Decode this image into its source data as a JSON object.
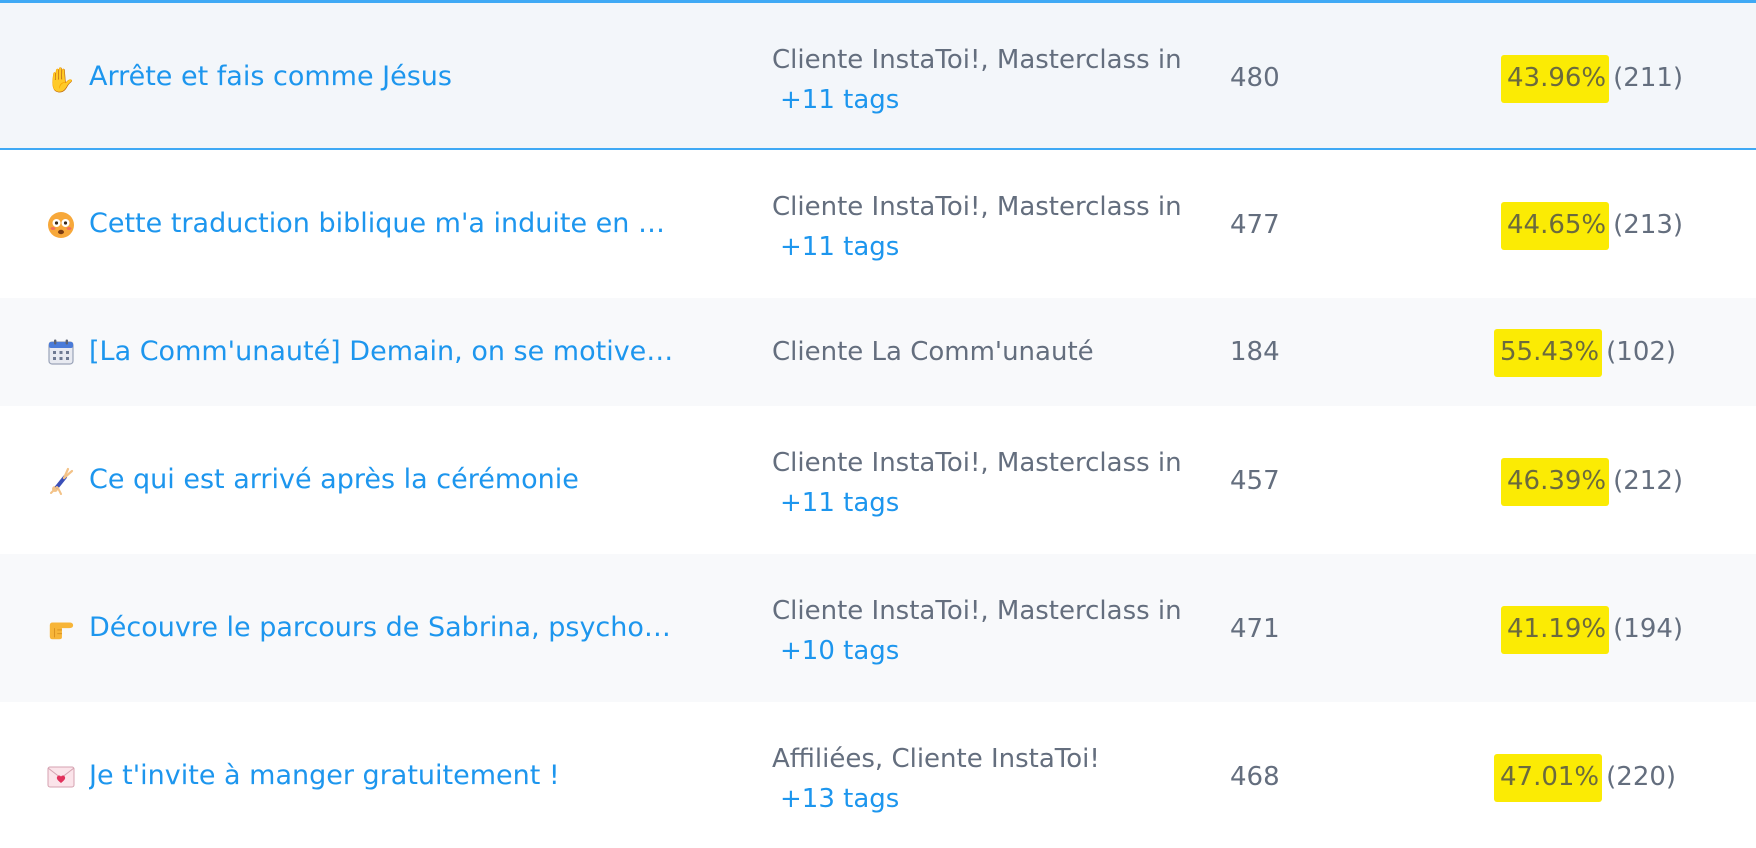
{
  "rows": [
    {
      "emoji": "raised-hand-icon",
      "title": "Arrête et fais comme Jésus",
      "tags": "Cliente InstaToi!, Masterclass instagram",
      "more_tags": "+11 tags",
      "count": "480",
      "rate": "43.96%",
      "rate_count": "(211)"
    },
    {
      "emoji": "flushed-face-icon",
      "title": "Cette traduction biblique m'a induite en erreur",
      "tags": "Cliente InstaToi!, Masterclass instagram",
      "more_tags": "+11 tags",
      "count": "477",
      "rate": "44.65%",
      "rate_count": "(213)"
    },
    {
      "emoji": "calendar-icon",
      "title": "[La Comm'unauté] Demain, on se motive pour",
      "tags": "Cliente La Comm'unauté",
      "more_tags": "",
      "count": "184",
      "rate": "55.43%",
      "rate_count": "(102)"
    },
    {
      "emoji": "cartwheel-icon",
      "title": "Ce qui est arrivé après la cérémonie",
      "tags": "Cliente InstaToi!, Masterclass instagram",
      "more_tags": "+11 tags",
      "count": "457",
      "rate": "46.39%",
      "rate_count": "(212)"
    },
    {
      "emoji": "pointing-right-icon",
      "title": "Découvre le parcours de Sabrina, psychothérapeute",
      "tags": "Cliente InstaToi!, Masterclass instagram",
      "more_tags": "+10 tags",
      "count": "471",
      "rate": "41.19%",
      "rate_count": "(194)"
    },
    {
      "emoji": "love-letter-icon",
      "title": "Je t'invite à manger gratuitement !",
      "tags": "Affiliées, Cliente InstaToi!",
      "more_tags": "+13 tags",
      "count": "468",
      "rate": "47.01%",
      "rate_count": "(220)"
    }
  ],
  "colors": {
    "link": "#1d96ee",
    "text": "#646e7e",
    "highlight": "#fbeb04",
    "selected_border": "#3fa9f5"
  }
}
